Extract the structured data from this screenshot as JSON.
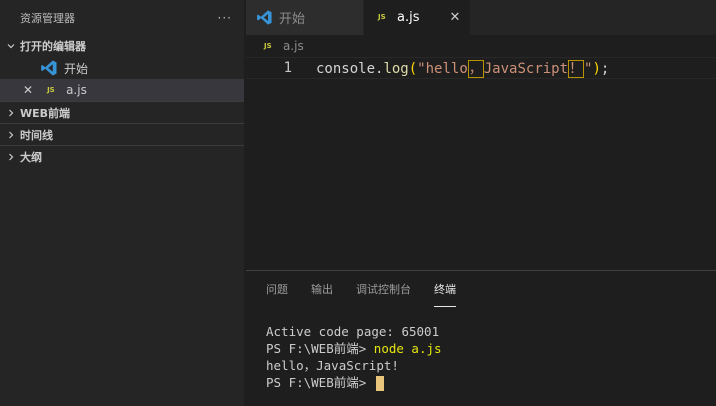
{
  "sidebar": {
    "title": "资源管理器",
    "more": "···",
    "open_editors": {
      "label": "打开的编辑器",
      "items": [
        {
          "label": "开始",
          "icon": "vscode-icon"
        },
        {
          "label": "a.js",
          "icon": "js-file-icon",
          "close": "✕"
        }
      ]
    },
    "sections": [
      {
        "label": "WEB前端"
      },
      {
        "label": "时间线"
      },
      {
        "label": "大纲"
      }
    ]
  },
  "editor": {
    "tabs": [
      {
        "label": "开始",
        "icon": "vscode-icon",
        "active": false
      },
      {
        "label": "a.js",
        "icon": "js-file-icon",
        "active": true,
        "close": "✕"
      }
    ],
    "breadcrumb": "a.js",
    "js_badge": "JS",
    "line_number": "1",
    "code": {
      "part1": "console.",
      "fn": "log",
      "open_paren": "(",
      "str1": "\"hello",
      "comma": "，",
      "str2": "JavaScript",
      "bang": "！",
      "str3": "\"",
      "close_paren": ")",
      "semi": ";"
    }
  },
  "panel": {
    "tabs": [
      "问题",
      "输出",
      "调试控制台",
      "终端"
    ],
    "active_tab": "终端",
    "terminal": {
      "line1": "Active code page: 65001",
      "prompt": "PS F:\\WEB前端> ",
      "command": "node a.js",
      "line3": "hello，JavaScript!",
      "prompt2": "PS F:\\WEB前端> "
    }
  },
  "colors": {
    "accent": "#007acc",
    "js_icon": "#cbcb41",
    "string": "#ce9178",
    "bracket": "#ffd700"
  }
}
